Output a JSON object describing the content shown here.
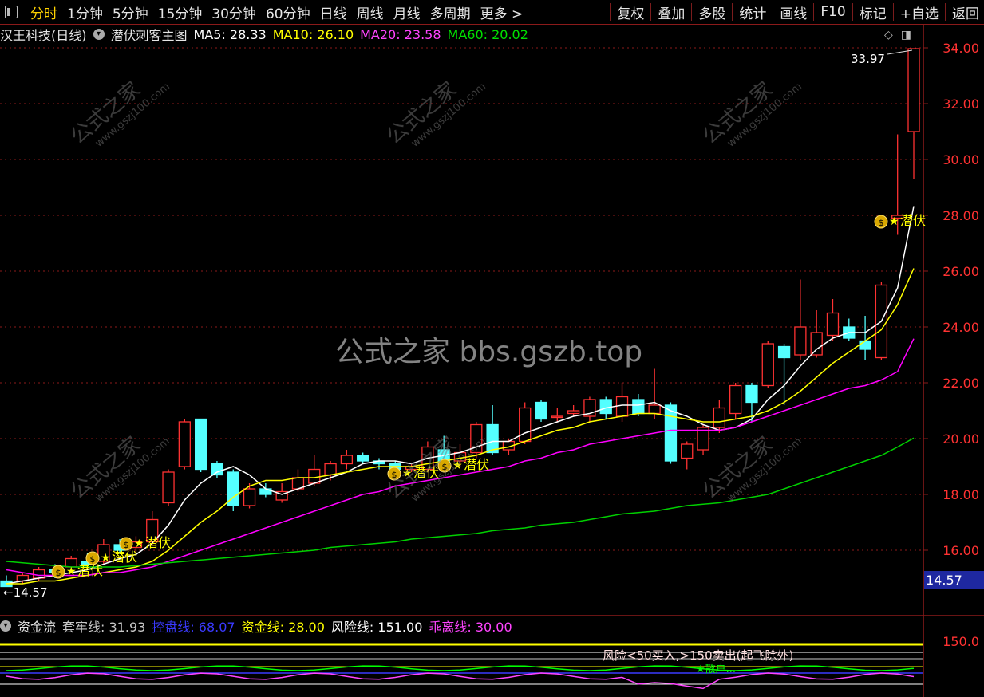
{
  "toolbar": {
    "tabs": [
      {
        "label": "分时",
        "active": true
      },
      {
        "label": "1分钟"
      },
      {
        "label": "5分钟"
      },
      {
        "label": "15分钟"
      },
      {
        "label": "30分钟"
      },
      {
        "label": "60分钟"
      },
      {
        "label": "日线"
      },
      {
        "label": "周线"
      },
      {
        "label": "月线"
      },
      {
        "label": "多周期"
      },
      {
        "label": "更多 >"
      }
    ],
    "right": [
      "复权",
      "叠加",
      "多股",
      "统计",
      "画线",
      "F10",
      "标记",
      "+自选",
      "返回"
    ]
  },
  "legend": {
    "title": "汉王科技(日线)",
    "template": "潜伏刺客主图",
    "ma5": "MA5: 28.33",
    "ma10": "MA10: 26.10",
    "ma20": "MA20: 23.58",
    "ma60": "MA60: 20.02"
  },
  "sub_legend": {
    "name": "资金流",
    "items": [
      {
        "text": "套牢线: 31.93",
        "color": "#c8c8c8"
      },
      {
        "text": "控盘线: 68.07",
        "color": "#3a3aff"
      },
      {
        "text": "资金线: 28.00",
        "color": "#ffff00"
      },
      {
        "text": "风险线: 151.00",
        "color": "#ffffff"
      },
      {
        "text": "乖离线: 30.00",
        "color": "#ff44ff"
      }
    ]
  },
  "watermark": {
    "center": "公式之家 bbs.gszb.top",
    "diag": "公式之家",
    "diag_url": "www.gszj100.com"
  },
  "annotations": {
    "high": "33.97",
    "low": "←14.57",
    "signal": "潜伏",
    "signal_mark": "★",
    "money_icon": "$",
    "sub_text": "风险<50买入,>150卖出(起飞除外)",
    "sub_label": "★散户..."
  },
  "colors": {
    "up": "#ff3232",
    "down": "#54ffff",
    "ma5": "#ffffff",
    "ma10": "#ffff00",
    "ma20": "#ff00ff",
    "ma60": "#00d000",
    "grid": "#8b1a1a",
    "axis_text": "#ff3232"
  },
  "chart_data": {
    "type": "candlestick",
    "y_axis": {
      "ticks": [
        16,
        18,
        20,
        22,
        24,
        26,
        28,
        30,
        32,
        34
      ],
      "range": [
        14.0,
        34.6
      ]
    },
    "sub_axis": {
      "ticks": [
        150.0
      ]
    },
    "last_price": "14.57",
    "candles": [
      {
        "o": 14.9,
        "h": 15.1,
        "l": 14.7,
        "c": 14.7
      },
      {
        "o": 14.9,
        "h": 15.2,
        "l": 14.8,
        "c": 15.1
      },
      {
        "o": 15.0,
        "h": 15.4,
        "l": 14.9,
        "c": 15.3
      },
      {
        "o": 15.3,
        "h": 15.5,
        "l": 15.0,
        "c": 15.2
      },
      {
        "o": 15.4,
        "h": 15.8,
        "l": 15.2,
        "c": 15.7
      },
      {
        "o": 15.6,
        "h": 15.9,
        "l": 15.4,
        "c": 15.5
      },
      {
        "o": 15.6,
        "h": 16.4,
        "l": 15.5,
        "c": 16.2
      },
      {
        "o": 16.2,
        "h": 16.4,
        "l": 15.9,
        "c": 16.0
      },
      {
        "o": 16.1,
        "h": 16.5,
        "l": 15.9,
        "c": 16.3
      },
      {
        "o": 16.3,
        "h": 17.4,
        "l": 16.2,
        "c": 17.1
      },
      {
        "o": 17.7,
        "h": 18.9,
        "l": 17.6,
        "c": 18.8
      },
      {
        "o": 19.0,
        "h": 20.7,
        "l": 18.9,
        "c": 20.6
      },
      {
        "o": 20.7,
        "h": 20.7,
        "l": 18.8,
        "c": 18.9
      },
      {
        "o": 19.1,
        "h": 19.2,
        "l": 18.6,
        "c": 18.7
      },
      {
        "o": 18.8,
        "h": 18.9,
        "l": 17.4,
        "c": 17.6
      },
      {
        "o": 17.6,
        "h": 18.4,
        "l": 17.5,
        "c": 18.2
      },
      {
        "o": 18.2,
        "h": 18.4,
        "l": 17.9,
        "c": 18.0
      },
      {
        "o": 17.8,
        "h": 18.4,
        "l": 17.7,
        "c": 18.1
      },
      {
        "o": 18.2,
        "h": 18.9,
        "l": 18.1,
        "c": 18.6
      },
      {
        "o": 18.4,
        "h": 19.4,
        "l": 18.3,
        "c": 18.9
      },
      {
        "o": 18.7,
        "h": 19.2,
        "l": 18.5,
        "c": 19.1
      },
      {
        "o": 19.1,
        "h": 19.6,
        "l": 18.9,
        "c": 19.4
      },
      {
        "o": 19.4,
        "h": 19.5,
        "l": 19.1,
        "c": 19.2
      },
      {
        "o": 19.2,
        "h": 19.3,
        "l": 18.9,
        "c": 19.1
      },
      {
        "o": 19.1,
        "h": 19.2,
        "l": 18.8,
        "c": 18.9
      },
      {
        "o": 18.9,
        "h": 19.1,
        "l": 18.8,
        "c": 19.0
      },
      {
        "o": 18.9,
        "h": 19.9,
        "l": 18.8,
        "c": 19.7
      },
      {
        "o": 19.6,
        "h": 20.1,
        "l": 19.0,
        "c": 19.1
      },
      {
        "o": 19.2,
        "h": 19.8,
        "l": 19.0,
        "c": 19.5
      },
      {
        "o": 19.5,
        "h": 20.6,
        "l": 19.3,
        "c": 20.5
      },
      {
        "o": 20.5,
        "h": 21.2,
        "l": 19.4,
        "c": 19.5
      },
      {
        "o": 19.6,
        "h": 20.0,
        "l": 19.4,
        "c": 19.9
      },
      {
        "o": 19.9,
        "h": 21.3,
        "l": 19.8,
        "c": 21.1
      },
      {
        "o": 21.3,
        "h": 21.4,
        "l": 20.6,
        "c": 20.7
      },
      {
        "o": 20.8,
        "h": 21.1,
        "l": 20.6,
        "c": 20.8
      },
      {
        "o": 20.9,
        "h": 21.2,
        "l": 20.8,
        "c": 21.0
      },
      {
        "o": 20.8,
        "h": 21.5,
        "l": 20.6,
        "c": 21.4
      },
      {
        "o": 21.4,
        "h": 21.5,
        "l": 20.7,
        "c": 20.9
      },
      {
        "o": 20.8,
        "h": 22.0,
        "l": 20.6,
        "c": 21.5
      },
      {
        "o": 21.4,
        "h": 21.6,
        "l": 20.8,
        "c": 20.9
      },
      {
        "o": 20.9,
        "h": 22.5,
        "l": 20.7,
        "c": 21.2
      },
      {
        "o": 21.2,
        "h": 21.3,
        "l": 19.1,
        "c": 19.2
      },
      {
        "o": 19.3,
        "h": 19.9,
        "l": 18.9,
        "c": 19.8
      },
      {
        "o": 19.6,
        "h": 20.5,
        "l": 19.4,
        "c": 20.4
      },
      {
        "o": 20.4,
        "h": 21.4,
        "l": 20.2,
        "c": 21.1
      },
      {
        "o": 20.9,
        "h": 22.0,
        "l": 20.7,
        "c": 21.9
      },
      {
        "o": 21.9,
        "h": 22.0,
        "l": 20.6,
        "c": 21.3
      },
      {
        "o": 21.9,
        "h": 23.5,
        "l": 21.8,
        "c": 23.4
      },
      {
        "o": 23.3,
        "h": 23.4,
        "l": 21.2,
        "c": 22.9
      },
      {
        "o": 23.0,
        "h": 25.7,
        "l": 22.8,
        "c": 24.0
      },
      {
        "o": 23.0,
        "h": 24.6,
        "l": 22.9,
        "c": 23.8
      },
      {
        "o": 23.7,
        "h": 25.0,
        "l": 23.5,
        "c": 24.5
      },
      {
        "o": 24.0,
        "h": 24.3,
        "l": 23.5,
        "c": 23.6
      },
      {
        "o": 23.5,
        "h": 24.4,
        "l": 22.8,
        "c": 23.2
      },
      {
        "o": 22.9,
        "h": 25.6,
        "l": 22.8,
        "c": 25.5
      },
      {
        "o": 27.9,
        "h": 30.9,
        "l": 27.3,
        "c": 28.0
      },
      {
        "o": 31.0,
        "h": 33.97,
        "l": 29.3,
        "c": 33.97
      }
    ],
    "ma5": [
      14.8,
      14.9,
      15.0,
      15.1,
      15.2,
      15.3,
      15.5,
      15.7,
      15.85,
      16.25,
      16.9,
      17.8,
      18.4,
      18.8,
      19.0,
      18.7,
      18.2,
      18.0,
      18.2,
      18.4,
      18.6,
      18.8,
      19.1,
      19.2,
      19.2,
      19.1,
      19.3,
      19.4,
      19.5,
      19.7,
      19.9,
      19.9,
      20.2,
      20.4,
      20.6,
      20.8,
      20.9,
      21.1,
      21.2,
      21.2,
      21.3,
      21.0,
      20.8,
      20.5,
      20.3,
      20.4,
      20.7,
      21.4,
      21.9,
      22.6,
      23.2,
      23.6,
      23.8,
      23.8,
      24.2,
      25.4,
      28.33
    ],
    "ma10": [
      14.8,
      14.8,
      14.9,
      14.9,
      15.0,
      15.1,
      15.2,
      15.3,
      15.4,
      15.6,
      16.0,
      16.5,
      17.0,
      17.4,
      17.9,
      18.3,
      18.5,
      18.5,
      18.6,
      18.6,
      18.7,
      18.8,
      18.9,
      19.0,
      19.0,
      19.0,
      19.1,
      19.2,
      19.3,
      19.4,
      19.6,
      19.7,
      19.9,
      20.1,
      20.3,
      20.4,
      20.6,
      20.7,
      20.8,
      20.9,
      20.9,
      20.8,
      20.7,
      20.6,
      20.6,
      20.7,
      20.8,
      21.0,
      21.3,
      21.7,
      22.2,
      22.7,
      23.1,
      23.5,
      23.9,
      24.8,
      26.1
    ],
    "ma20": [
      15.3,
      15.2,
      15.1,
      15.1,
      15.1,
      15.1,
      15.2,
      15.2,
      15.3,
      15.4,
      15.6,
      15.8,
      16.0,
      16.2,
      16.4,
      16.6,
      16.8,
      17.0,
      17.2,
      17.4,
      17.6,
      17.8,
      18.0,
      18.1,
      18.3,
      18.4,
      18.5,
      18.6,
      18.7,
      18.8,
      18.9,
      19.0,
      19.2,
      19.3,
      19.5,
      19.6,
      19.8,
      19.9,
      20.0,
      20.1,
      20.2,
      20.3,
      20.3,
      20.3,
      20.3,
      20.4,
      20.6,
      20.8,
      21.0,
      21.2,
      21.4,
      21.6,
      21.8,
      21.9,
      22.1,
      22.4,
      23.58
    ],
    "ma60": [
      15.6,
      15.55,
      15.5,
      15.45,
      15.4,
      15.4,
      15.4,
      15.4,
      15.45,
      15.5,
      15.55,
      15.6,
      15.65,
      15.7,
      15.75,
      15.8,
      15.85,
      15.9,
      15.95,
      16.0,
      16.1,
      16.15,
      16.2,
      16.25,
      16.3,
      16.4,
      16.45,
      16.5,
      16.55,
      16.6,
      16.7,
      16.75,
      16.8,
      16.9,
      16.95,
      17.0,
      17.1,
      17.2,
      17.3,
      17.35,
      17.4,
      17.5,
      17.6,
      17.65,
      17.7,
      17.8,
      17.9,
      18.0,
      18.2,
      18.4,
      18.6,
      18.8,
      19.0,
      19.2,
      19.4,
      19.7,
      20.02
    ]
  }
}
